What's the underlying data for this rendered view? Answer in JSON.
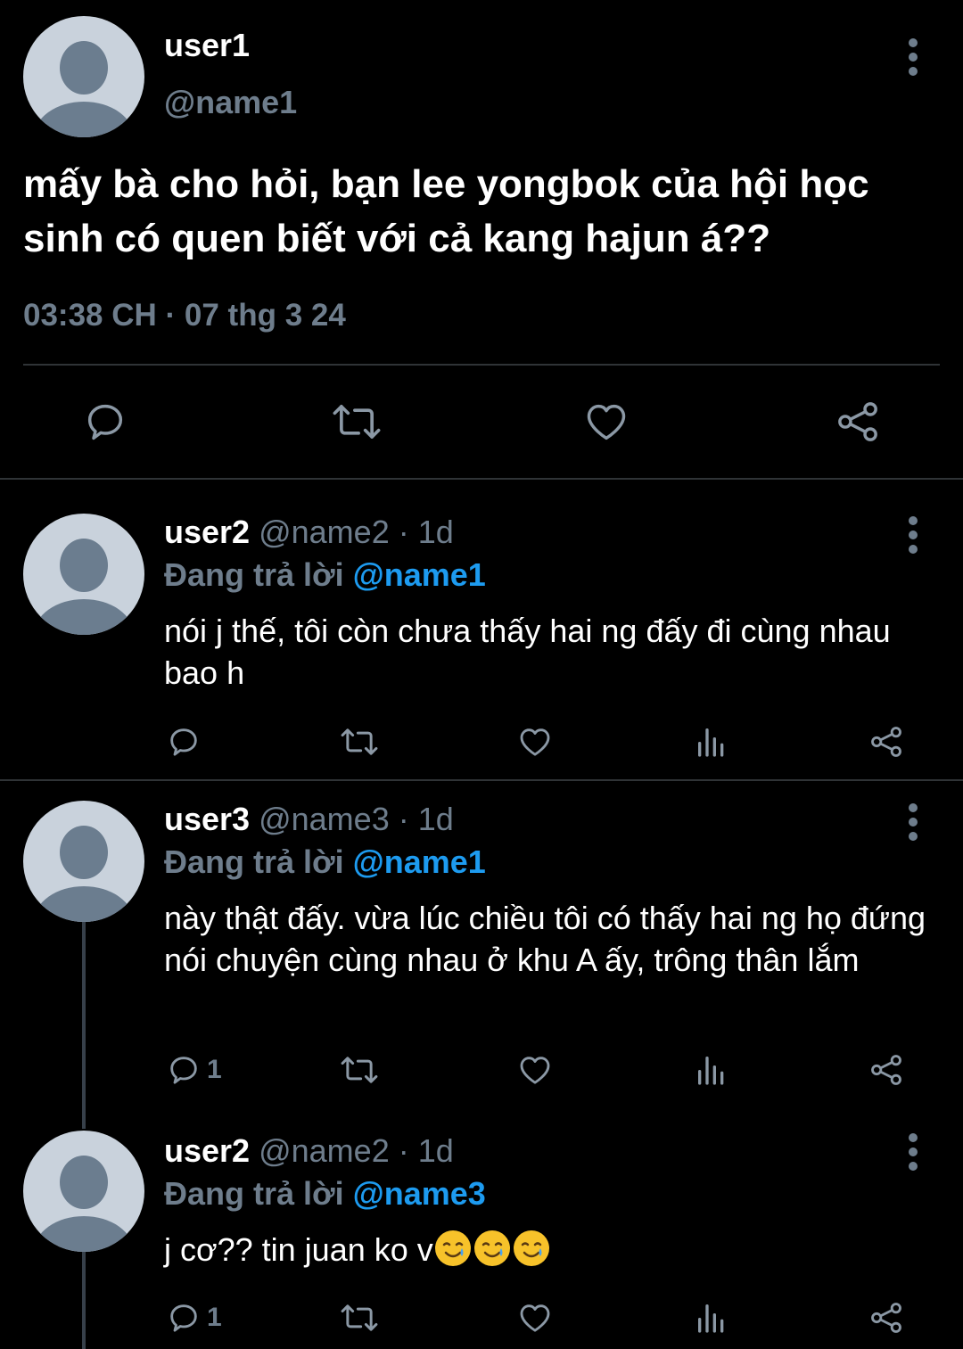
{
  "main": {
    "username": "user1",
    "handle": "@name1",
    "text": "mấy bà cho hỏi, bạn lee yongbok của hội học sinh có quen biết với cả kang hajun á??",
    "time": "03:38 CH · 07 thg 3 24"
  },
  "replies": [
    {
      "username": "user2",
      "handle_time": "@name2 · 1d",
      "replying_label": "Đang trả lời",
      "replying_to": "@name1",
      "text": "nói j thế, tôi còn chưa thấy hai ng đấy đi cùng nhau bao h",
      "reply_count": ""
    },
    {
      "username": "user3",
      "handle_time": "@name3 · 1d",
      "replying_label": "Đang trả lời",
      "replying_to": "@name1",
      "text": "này thật đấy. vừa lúc chiều tôi có thấy hai ng họ đứng nói chuyện cùng nhau ở khu A ấy, trông thân lắm",
      "reply_count": "1"
    },
    {
      "username": "user2",
      "handle_time": "@name2 · 1d",
      "replying_label": "Đang trả lời",
      "replying_to": "@name3",
      "text": "j cơ?? tin juan ko v",
      "emoji": [
        "crying-smile-emoji",
        "crying-smile-emoji",
        "crying-smile-emoji"
      ],
      "reply_count": "1"
    }
  ],
  "colors": {
    "background": "#000000",
    "muted": "#6e7d8c",
    "accent": "#1d9bf0",
    "divider": "#2f3336",
    "avatar": "#c9d2dc"
  },
  "icons": [
    "reply-icon",
    "retweet-icon",
    "like-icon",
    "views-icon",
    "share-icon",
    "more-icon"
  ]
}
